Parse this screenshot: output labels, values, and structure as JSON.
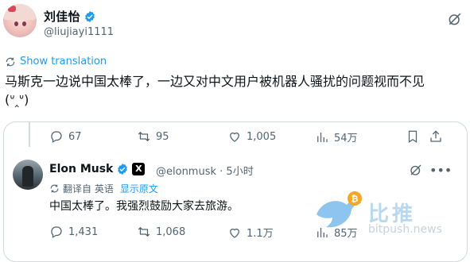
{
  "post": {
    "author_name": "刘佳怡",
    "author_handle": "@liujiayi1111",
    "show_translation": "Show translation",
    "text": "马斯克一边说中国太棒了，一边又对中文用户被机器人骚扰的问题视而不见",
    "emoticon": "(ᐡ‸ᐡ)"
  },
  "quote_stats": {
    "replies": "67",
    "reposts": "95",
    "likes": "1,005",
    "views": "54万"
  },
  "quoted": {
    "author_name": "Elon Musk",
    "author_handle": "@elonmusk",
    "time": "· 5小时",
    "translate_label": "翻译自 英语",
    "translate_link": "显示原文",
    "text": "中国太棒了。我强烈鼓励大家去旅游。",
    "replies": "1,431",
    "reposts": "1,068",
    "likes": "1.1万",
    "views": "85万"
  },
  "watermark": {
    "brand": "比推",
    "url": "bitpush.news"
  },
  "colors": {
    "accent": "#1d9bf0",
    "muted": "#536471",
    "verified": "#1d9bf0"
  }
}
